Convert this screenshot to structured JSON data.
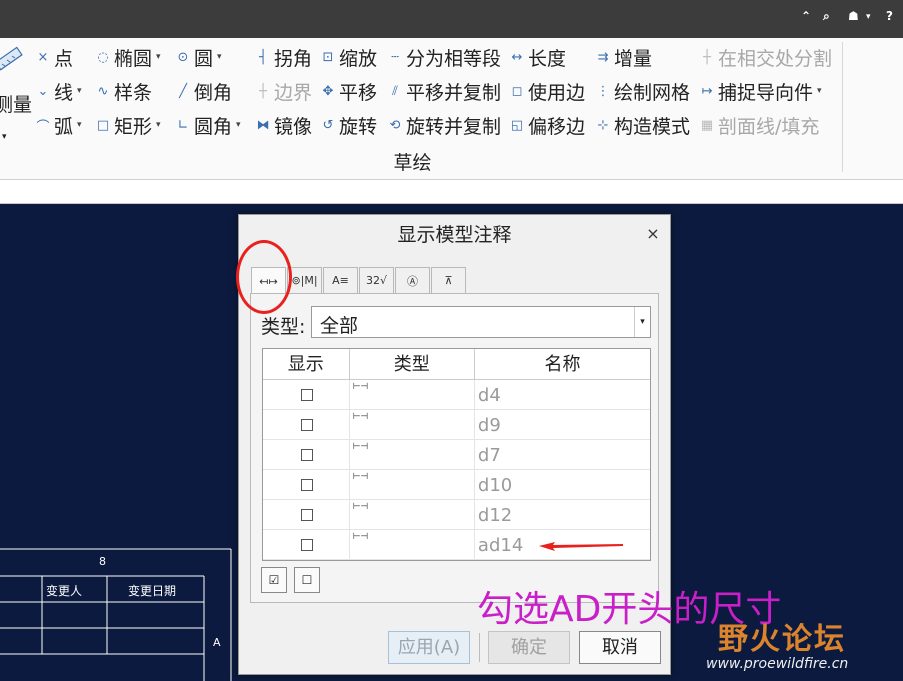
{
  "topbar": {
    "icons": [
      "chevron-up-icon",
      "search-icon",
      "graduation-cap-icon",
      "chevron-down-icon",
      "help-icon"
    ],
    "up": "⌃",
    "search": "⌕",
    "cap": "☗",
    "caret": "▾",
    "help": "?"
  },
  "ribbon": {
    "group_label": "草绘",
    "measure_label": "测量",
    "col1": [
      {
        "label": "点",
        "icon": "×"
      },
      {
        "label": "线",
        "icon": "⌄",
        "dropdown": true
      },
      {
        "label": "弧",
        "icon": "⌒",
        "dropdown": true
      }
    ],
    "col2": [
      {
        "label": "椭圆",
        "icon": "◌",
        "dropdown": true
      },
      {
        "label": "样条",
        "icon": "∿"
      },
      {
        "label": "矩形",
        "icon": "□",
        "dropdown": true
      }
    ],
    "col3": [
      {
        "label": "圆",
        "icon": "⊙",
        "dropdown": true
      },
      {
        "label": "倒角",
        "icon": "╱"
      },
      {
        "label": "圆角",
        "icon": "∟",
        "dropdown": true
      }
    ],
    "col4": [
      {
        "label": "拐角",
        "icon": "┤"
      },
      {
        "label": "边界",
        "icon": "┼",
        "disabled": true
      },
      {
        "label": "镜像",
        "icon": "⧓"
      }
    ],
    "col5": [
      {
        "label": "缩放",
        "icon": "⊡"
      },
      {
        "label": "平移",
        "icon": "✥"
      },
      {
        "label": "旋转",
        "icon": "↺"
      }
    ],
    "col6": [
      {
        "label": "分为相等段",
        "icon": "┄"
      },
      {
        "label": "平移并复制",
        "icon": "⫽"
      },
      {
        "label": "旋转并复制",
        "icon": "⟲"
      }
    ],
    "col7": [
      {
        "label": "长度",
        "icon": "↔"
      },
      {
        "label": "使用边",
        "icon": "◻"
      },
      {
        "label": "偏移边",
        "icon": "◱"
      }
    ],
    "col8": [
      {
        "label": "增量",
        "icon": "⇉"
      },
      {
        "label": "绘制网格",
        "icon": "⋮"
      },
      {
        "label": "构造模式",
        "icon": "⊹"
      }
    ],
    "col9": [
      {
        "label": "在相交处分割",
        "icon": "┼",
        "disabled": true
      },
      {
        "label": "捕捉导向件",
        "icon": "↦",
        "dropdown": true
      },
      {
        "label": "剖面线/填充",
        "icon": "▦",
        "disabled": true
      }
    ]
  },
  "drawing_table": {
    "header": "8",
    "col_a": "变更人",
    "col_b": "变更日期",
    "side": "A"
  },
  "dialog": {
    "title": "显示模型注释",
    "close": "×",
    "tabs": [
      {
        "name": "tab-dimension",
        "glyph": "↤↦"
      },
      {
        "name": "tab-geometric-tolerance",
        "glyph": "⊚|M|"
      },
      {
        "name": "tab-note",
        "glyph": "A≡"
      },
      {
        "name": "tab-surface-finish",
        "glyph": "32√"
      },
      {
        "name": "tab-symbol",
        "glyph": "Ⓐ"
      },
      {
        "name": "tab-datum",
        "glyph": "⊼"
      }
    ],
    "type_label": "类型:",
    "type_value": "全部",
    "columns": [
      "显示",
      "类型",
      "名称"
    ],
    "rows": [
      {
        "name": "d4",
        "type_glyph": "⊢⊣",
        "checked": false
      },
      {
        "name": "d9",
        "type_glyph": "⊢⊣",
        "checked": false
      },
      {
        "name": "d7",
        "type_glyph": "⊢⊣",
        "checked": false
      },
      {
        "name": "d10",
        "type_glyph": "⊢⊣",
        "checked": false
      },
      {
        "name": "d12",
        "type_glyph": "⊢⊣",
        "checked": false
      },
      {
        "name": "ad14",
        "type_glyph": "⊢⊣",
        "checked": false
      }
    ],
    "select_all": "☑",
    "deselect_all": "☐",
    "apply": "应用(A)",
    "ok": "确定",
    "cancel": "取消"
  },
  "annotation": {
    "note": "勾选AD开头的尺寸",
    "ring_color": "#e8211d",
    "note_color": "#c81fc8"
  },
  "watermark": {
    "title": "野火论坛",
    "url": "www.proewildfire.cn"
  }
}
